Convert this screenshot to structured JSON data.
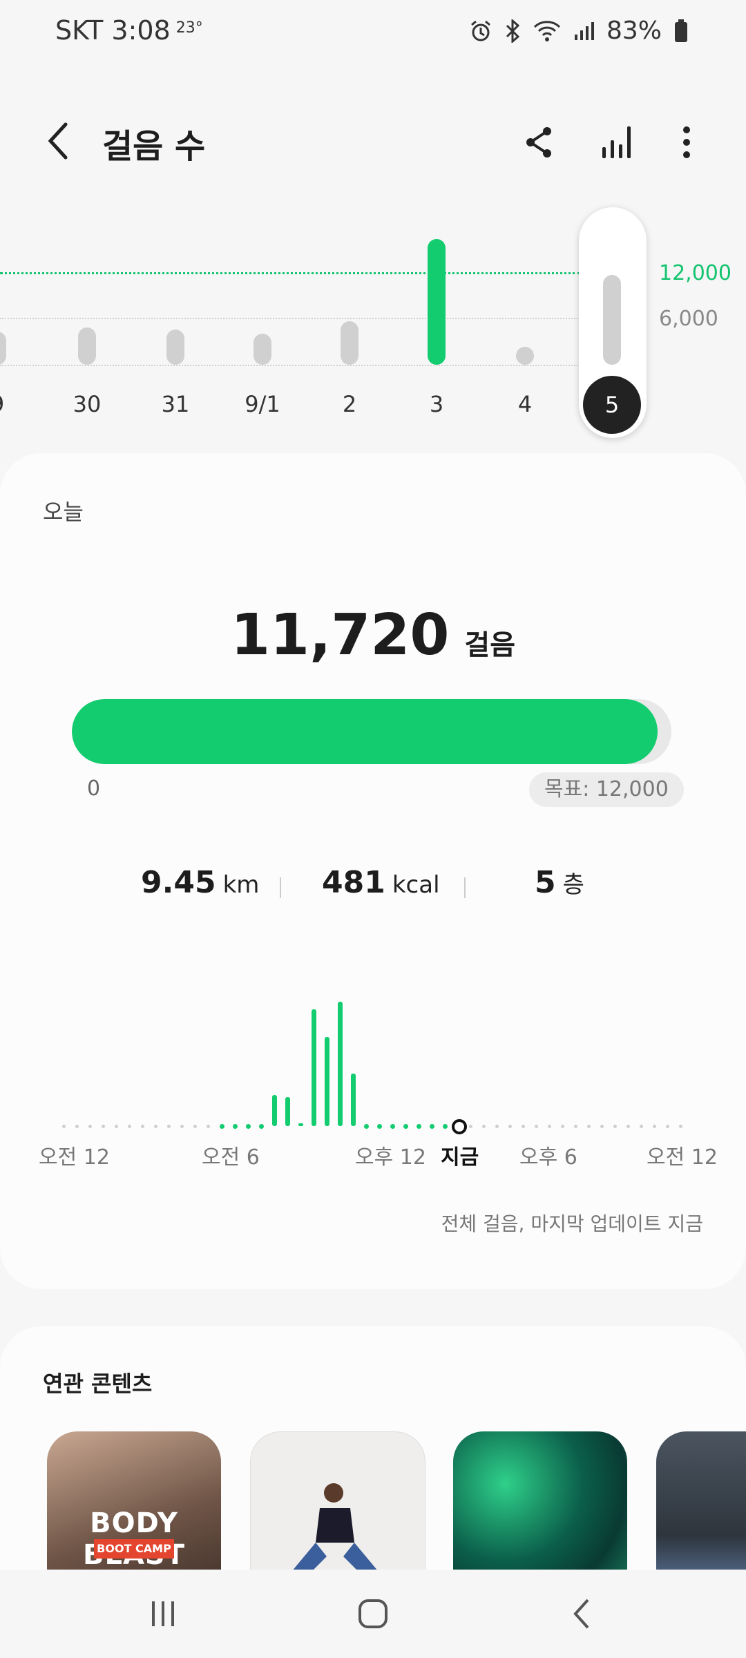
{
  "status_bar": {
    "carrier_time": "SKT 3:08",
    "temperature": "23°",
    "battery": "83%",
    "icons": [
      "alarm-icon",
      "bluetooth-icon",
      "wifi-icon",
      "signal-icon",
      "battery-icon"
    ]
  },
  "header": {
    "title": "걸음 수",
    "back_icon": "back-arrow-icon",
    "actions": [
      "share-icon",
      "chart-icon",
      "more-icon"
    ]
  },
  "weekly": {
    "days": [
      {
        "label": "9",
        "value": 4300
      },
      {
        "label": "30",
        "value": 4800
      },
      {
        "label": "31",
        "value": 4600
      },
      {
        "label": "9/1",
        "value": 4000
      },
      {
        "label": "2",
        "value": 5600
      },
      {
        "label": "3",
        "value": 11900,
        "goal_met": true
      },
      {
        "label": "4",
        "value": 300
      },
      {
        "label": "5",
        "value": 11720,
        "selected": true
      }
    ],
    "goal_label": "12,000",
    "mid_label": "6,000"
  },
  "today": {
    "label": "오늘",
    "steps": "11,720",
    "steps_unit": "걸음",
    "progress": 0.9767,
    "progress_min": "0",
    "goal_label": "목표: 12,000",
    "distance": "9.45",
    "distance_unit": "km",
    "calories": "481",
    "calories_unit": "kcal",
    "floors": "5",
    "floors_unit": "층",
    "time_labels": [
      "오전 12",
      "오전 6",
      "오후 12",
      "지금",
      "오후 6",
      "오전 12"
    ],
    "update_text": "전체 걸음, 마지막 업데이트 지금"
  },
  "chart_data": {
    "type": "bar",
    "title": "",
    "x": [
      10,
      11,
      12,
      13,
      14,
      15,
      16,
      17,
      18,
      19,
      20,
      21,
      22,
      23,
      24,
      25,
      26,
      27,
      28,
      29
    ],
    "values": [
      30,
      30,
      30,
      60,
      1600,
      1500,
      150,
      6000,
      4600,
      6400,
      2700,
      40,
      40,
      40,
      40,
      40,
      40,
      0,
      0,
      0
    ],
    "xlabel": "",
    "ylabel": ""
  },
  "related": {
    "title": "연관 콘텐츠",
    "items": [
      {
        "name": "body-blast-thumb",
        "title": "BODY BLAST",
        "subtitle": "BOOT CAMP"
      },
      {
        "name": "stretch-thumb"
      },
      {
        "name": "green-swirl-thumb"
      },
      {
        "name": "couch-thumb"
      }
    ]
  },
  "nav": [
    "recent-apps-icon",
    "home-icon",
    "back-icon"
  ]
}
